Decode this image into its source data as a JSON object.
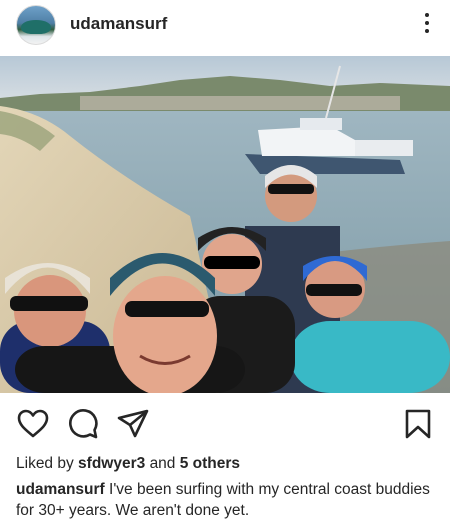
{
  "header": {
    "username": "udamansurf",
    "avatar_icon": "surf-wave-avatar",
    "more_icon": "more-options-icon"
  },
  "photo": {
    "icon": "selfie-photo",
    "colors": {
      "sky": "#c9d6df",
      "water": "#8aa6b3",
      "sand": "#d8c9a6"
    }
  },
  "actions": {
    "like_icon": "heart-icon",
    "comment_icon": "comment-icon",
    "share_icon": "share-icon",
    "save_icon": "bookmark-icon"
  },
  "likes": {
    "prefix": "Liked by",
    "user": "sfdwyer3",
    "and": "and",
    "others": "5 others"
  },
  "caption": {
    "username": "udamansurf",
    "text": "I've been surfing with my central coast buddies for 30+ years. We aren't done yet."
  }
}
